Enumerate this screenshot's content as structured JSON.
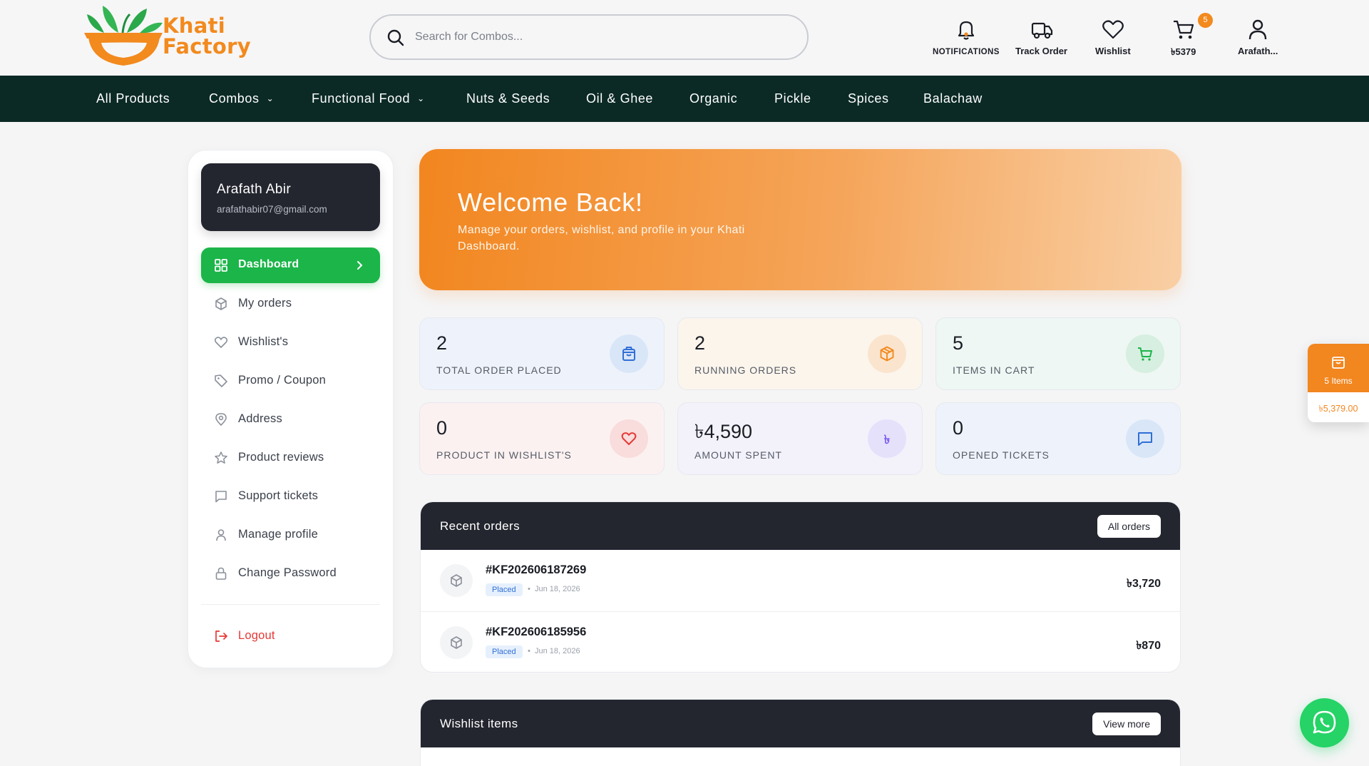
{
  "header": {
    "brand_line1": "Khati",
    "brand_line2": "Factory",
    "search_placeholder": "Search for Combos...",
    "actions": {
      "notifications": "NOTIFICATIONS",
      "track_order": "Track Order",
      "wishlist": "Wishlist",
      "cart_amount": "৳5379",
      "cart_count": "5",
      "account": "Arafath..."
    }
  },
  "nav": {
    "items": [
      "All Products",
      "Combos",
      "Functional Food",
      "Nuts & Seeds",
      "Oil & Ghee",
      "Organic",
      "Pickle",
      "Spices",
      "Balachaw"
    ]
  },
  "profile": {
    "name": "Arafath Abir",
    "email": "arafathabir07@gmail.com"
  },
  "sidebar": {
    "items": [
      "Dashboard",
      "My orders",
      "Wishlist's",
      "Promo / Coupon",
      "Address",
      "Product reviews",
      "Support tickets",
      "Manage profile",
      "Change Password"
    ],
    "active": "Dashboard",
    "logout": "Logout"
  },
  "welcome": {
    "title": "Welcome Back!",
    "subtitle": "Manage your orders, wishlist, and profile in your Khati Dashboard."
  },
  "stats": [
    {
      "value": "2",
      "label": "TOTAL ORDER PLACED",
      "icon": "shopping-bag-icon"
    },
    {
      "value": "2",
      "label": "RUNNING ORDERS",
      "icon": "package-icon"
    },
    {
      "value": "5",
      "label": "ITEMS IN CART",
      "icon": "cart-icon"
    },
    {
      "value": "0",
      "label": "PRODUCT IN WISHLIST'S",
      "icon": "heart-icon"
    },
    {
      "value": "৳4,590",
      "label": "AMOUNT SPENT",
      "icon": "taka-icon",
      "icon_text": "৳"
    },
    {
      "value": "0",
      "label": "OPENED TICKETS",
      "icon": "chat-icon"
    }
  ],
  "recent_orders": {
    "title": "Recent orders",
    "button": "All orders",
    "orders": [
      {
        "id": "#KF202606187269",
        "status": "Placed",
        "date": "Jun 18, 2026",
        "amount": "৳3,720"
      },
      {
        "id": "#KF202606185956",
        "status": "Placed",
        "date": "Jun 18, 2026",
        "amount": "৳870"
      }
    ]
  },
  "wishlist_panel": {
    "title": "Wishlist items",
    "button": "View more"
  },
  "float_cart": {
    "items": "5 Items",
    "total": "৳5,379.00"
  },
  "colors": {
    "brand_orange": "#f28a1e",
    "brand_green": "#1bb549",
    "nav_bg": "#0b2a26",
    "dark_card": "#23262f"
  }
}
